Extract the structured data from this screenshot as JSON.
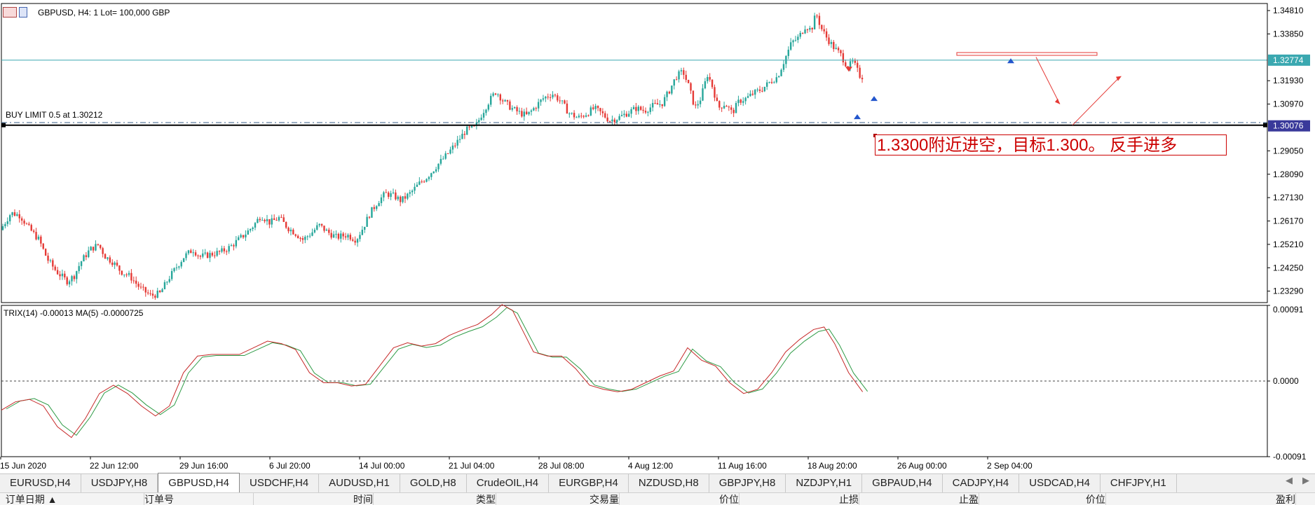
{
  "header": {
    "symbol_info": "GBPUSD, H4:  1 Lot= 100,000 GBP",
    "pending_order": "BUY LIMIT 0.5 at 1.30212",
    "indicator": "TRIX(14) -0.00013 MA(5) -0.0000725"
  },
  "annotation": "1.3300附近进空，目标1.300。 反手进多",
  "price_axis": {
    "ticks": [
      "1.34810",
      "1.33850",
      "1.32774",
      "1.31930",
      "1.30970",
      "1.30076",
      "1.29050",
      "1.28090",
      "1.27130",
      "1.26170",
      "1.25210",
      "1.24250",
      "1.23290"
    ],
    "current_bid": "1.32774",
    "order_price": "1.30076"
  },
  "indicator_axis": {
    "ticks": [
      "0.00091",
      "0.0000",
      "-0.00091"
    ]
  },
  "time_axis": [
    "15 Jun 2020",
    "22 Jun 12:00",
    "29 Jun 16:00",
    "6 Jul 20:00",
    "14 Jul 00:00",
    "21 Jul 04:00",
    "28 Jul 08:00",
    "4 Aug 12:00",
    "11 Aug 16:00",
    "18 Aug 20:00",
    "26 Aug 00:00",
    "2 Sep 04:00"
  ],
  "colors": {
    "bull": "#26a69a",
    "bear": "#e53935",
    "bid_line": "#3aa8b0",
    "order_label": "#39399a",
    "annotation": "#cc0000"
  },
  "chart_data": {
    "type": "candlestick",
    "symbol": "GBPUSD",
    "timeframe": "H4",
    "ylim": [
      1.2282,
      1.351
    ],
    "close_path": [
      [
        0,
        1.258
      ],
      [
        15,
        1.265
      ],
      [
        28,
        1.264
      ],
      [
        40,
        1.259
      ],
      [
        55,
        1.254
      ],
      [
        67,
        1.246
      ],
      [
        80,
        1.241
      ],
      [
        95,
        1.237
      ],
      [
        105,
        1.239
      ],
      [
        115,
        1.245
      ],
      [
        128,
        1.25
      ],
      [
        140,
        1.252
      ],
      [
        150,
        1.247
      ],
      [
        160,
        1.245
      ],
      [
        172,
        1.241
      ],
      [
        185,
        1.239
      ],
      [
        200,
        1.234
      ],
      [
        215,
        1.231
      ],
      [
        228,
        1.232
      ],
      [
        240,
        1.238
      ],
      [
        252,
        1.243
      ],
      [
        262,
        1.247
      ],
      [
        275,
        1.25
      ],
      [
        285,
        1.247
      ],
      [
        300,
        1.248
      ],
      [
        315,
        1.249
      ],
      [
        328,
        1.251
      ],
      [
        340,
        1.254
      ],
      [
        352,
        1.257
      ],
      [
        362,
        1.26
      ],
      [
        372,
        1.264
      ],
      [
        385,
        1.261
      ],
      [
        398,
        1.263
      ],
      [
        410,
        1.259
      ],
      [
        420,
        1.257
      ],
      [
        432,
        1.254
      ],
      [
        445,
        1.257
      ],
      [
        455,
        1.26
      ],
      [
        468,
        1.257
      ],
      [
        480,
        1.255
      ],
      [
        495,
        1.256
      ],
      [
        508,
        1.254
      ],
      [
        518,
        1.259
      ],
      [
        528,
        1.265
      ],
      [
        540,
        1.27
      ],
      [
        550,
        1.273
      ],
      [
        562,
        1.272
      ],
      [
        572,
        1.27
      ],
      [
        585,
        1.273
      ],
      [
        598,
        1.277
      ],
      [
        610,
        1.28
      ],
      [
        625,
        1.285
      ],
      [
        638,
        1.289
      ],
      [
        652,
        1.294
      ],
      [
        665,
        1.299
      ],
      [
        678,
        1.3
      ],
      [
        688,
        1.306
      ],
      [
        698,
        1.311
      ],
      [
        708,
        1.315
      ],
      [
        718,
        1.311
      ],
      [
        730,
        1.308
      ],
      [
        742,
        1.306
      ],
      [
        752,
        1.305
      ],
      [
        762,
        1.308
      ],
      [
        775,
        1.312
      ],
      [
        788,
        1.314
      ],
      [
        800,
        1.311
      ],
      [
        812,
        1.306
      ],
      [
        825,
        1.304
      ],
      [
        838,
        1.306
      ],
      [
        848,
        1.308
      ],
      [
        858,
        1.306
      ],
      [
        870,
        1.303
      ],
      [
        882,
        1.304
      ],
      [
        895,
        1.306
      ],
      [
        908,
        1.308
      ],
      [
        920,
        1.307
      ],
      [
        932,
        1.309
      ],
      [
        945,
        1.31
      ],
      [
        955,
        1.315
      ],
      [
        965,
        1.321
      ],
      [
        975,
        1.323
      ],
      [
        983,
        1.317
      ],
      [
        992,
        1.308
      ],
      [
        1000,
        1.312
      ],
      [
        1010,
        1.322
      ],
      [
        1018,
        1.316
      ],
      [
        1025,
        1.308
      ],
      [
        1035,
        1.31
      ],
      [
        1045,
        1.306
      ],
      [
        1055,
        1.311
      ],
      [
        1065,
        1.312
      ],
      [
        1075,
        1.314
      ],
      [
        1088,
        1.316
      ],
      [
        1100,
        1.319
      ],
      [
        1110,
        1.321
      ],
      [
        1120,
        1.328
      ],
      [
        1130,
        1.335
      ],
      [
        1140,
        1.337
      ],
      [
        1150,
        1.342
      ],
      [
        1158,
        1.34
      ],
      [
        1165,
        1.347
      ],
      [
        1172,
        1.341
      ],
      [
        1180,
        1.337
      ],
      [
        1190,
        1.333
      ],
      [
        1200,
        1.33
      ],
      [
        1210,
        1.325
      ],
      [
        1218,
        1.327
      ],
      [
        1228,
        1.321
      ]
    ],
    "trix_path": [
      [
        0,
        -0.00035
      ],
      [
        20,
        -0.00025
      ],
      [
        40,
        -0.00022
      ],
      [
        60,
        -0.0003
      ],
      [
        80,
        -0.00055
      ],
      [
        100,
        -0.00068
      ],
      [
        120,
        -0.00045
      ],
      [
        140,
        -0.00015
      ],
      [
        160,
        -5e-05
      ],
      [
        180,
        -0.00015
      ],
      [
        200,
        -0.0003
      ],
      [
        220,
        -0.00042
      ],
      [
        240,
        -0.0003
      ],
      [
        260,
        0.0001
      ],
      [
        280,
        0.0003
      ],
      [
        300,
        0.00032
      ],
      [
        320,
        0.00032
      ],
      [
        340,
        0.00032
      ],
      [
        360,
        0.0004
      ],
      [
        380,
        0.00048
      ],
      [
        400,
        0.00045
      ],
      [
        420,
        0.00038
      ],
      [
        440,
        0.0001
      ],
      [
        460,
        -2e-05
      ],
      [
        480,
        -2e-05
      ],
      [
        500,
        -6e-05
      ],
      [
        520,
        -4e-05
      ],
      [
        540,
        0.00018
      ],
      [
        560,
        0.0004
      ],
      [
        580,
        0.00046
      ],
      [
        600,
        0.00042
      ],
      [
        620,
        0.00045
      ],
      [
        640,
        0.00055
      ],
      [
        660,
        0.00062
      ],
      [
        680,
        0.00068
      ],
      [
        700,
        0.0008
      ],
      [
        715,
        0.00092
      ],
      [
        730,
        0.00085
      ],
      [
        745,
        0.0006
      ],
      [
        760,
        0.00035
      ],
      [
        780,
        0.0003
      ],
      [
        800,
        0.0003
      ],
      [
        820,
        0.00015
      ],
      [
        840,
        -5e-05
      ],
      [
        860,
        -0.0001
      ],
      [
        880,
        -0.00013
      ],
      [
        900,
        -0.0001
      ],
      [
        920,
        -2e-05
      ],
      [
        940,
        6e-05
      ],
      [
        960,
        0.00012
      ],
      [
        980,
        0.0004
      ],
      [
        1000,
        0.00025
      ],
      [
        1020,
        0.00018
      ],
      [
        1040,
        -2e-05
      ],
      [
        1060,
        -0.00015
      ],
      [
        1080,
        -0.0001
      ],
      [
        1100,
        0.0001
      ],
      [
        1120,
        0.00035
      ],
      [
        1140,
        0.0005
      ],
      [
        1160,
        0.00062
      ],
      [
        1175,
        0.00065
      ],
      [
        1190,
        0.00045
      ],
      [
        1210,
        0.0001
      ],
      [
        1230,
        -0.00013
      ]
    ],
    "trix_ylim": [
      -0.00091,
      0.00091
    ]
  }
}
